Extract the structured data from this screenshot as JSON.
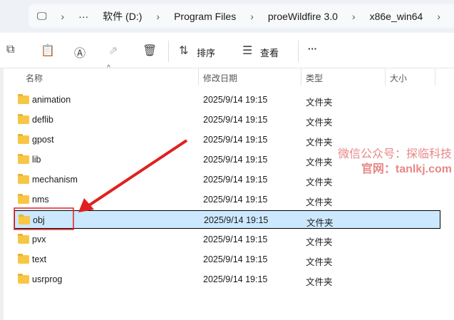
{
  "breadcrumb": [
    "软件 (D:)",
    "Program Files",
    "proeWildfire 3.0",
    "x86e_win64"
  ],
  "toolbar": {
    "sort": "排序",
    "view": "查看",
    "more": "···"
  },
  "columns": [
    "名称",
    "修改日期",
    "类型",
    "大小"
  ],
  "files": [
    {
      "name": "animation",
      "date": "2025/9/14 19:15",
      "type": "文件夹"
    },
    {
      "name": "deflib",
      "date": "2025/9/14 19:15",
      "type": "文件夹"
    },
    {
      "name": "gpost",
      "date": "2025/9/14 19:15",
      "type": "文件夹"
    },
    {
      "name": "lib",
      "date": "2025/9/14 19:15",
      "type": "文件夹"
    },
    {
      "name": "mechanism",
      "date": "2025/9/14 19:15",
      "type": "文件夹"
    },
    {
      "name": "nms",
      "date": "2025/9/14 19:15",
      "type": "文件夹"
    },
    {
      "name": "obj",
      "date": "2025/9/14 19:15",
      "type": "文件夹"
    },
    {
      "name": "pvx",
      "date": "2025/9/14 19:15",
      "type": "文件夹"
    },
    {
      "name": "text",
      "date": "2025/9/14 19:15",
      "type": "文件夹"
    },
    {
      "name": "usrprog",
      "date": "2025/9/14 19:15",
      "type": "文件夹"
    }
  ],
  "selected_index": 6,
  "watermark": {
    "line1": "微信公众号：探临科技",
    "line2": "官网：tanlkj.com"
  },
  "annotation_color": "#e02020"
}
